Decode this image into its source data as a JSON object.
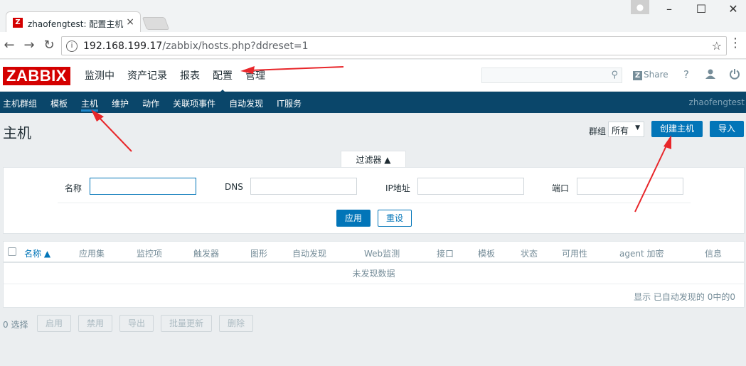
{
  "browser": {
    "tab_title": "zhaofengtest: 配置主机",
    "tab_close": "×",
    "url_host": "192.168.199.17",
    "url_path": "/zabbix/hosts.php?ddreset=1",
    "info_icon": "i"
  },
  "header": {
    "logo": "ZABBIX",
    "menu": [
      "监测中",
      "资产记录",
      "报表",
      "配置",
      "管理"
    ],
    "share_label": "Share",
    "help_label": "?"
  },
  "subnav": {
    "items": [
      "主机群组",
      "模板",
      "主机",
      "维护",
      "动作",
      "关联项事件",
      "自动发现",
      "IT服务"
    ],
    "user": "zhaofengtest"
  },
  "page": {
    "title": "主机",
    "group_label": "群组",
    "group_value": "所有",
    "create_button": "创建主机",
    "import_button": "导入"
  },
  "filter": {
    "tab_label": "过滤器 ▲",
    "name_label": "名称",
    "dns_label": "DNS",
    "ip_label": "IP地址",
    "port_label": "端口",
    "apply_button": "应用",
    "reset_button": "重设"
  },
  "table": {
    "columns": [
      "名称 ▲",
      "应用集",
      "监控项",
      "触发器",
      "图形",
      "自动发现",
      "Web监测",
      "接口",
      "模板",
      "状态",
      "可用性",
      "agent 加密",
      "信息"
    ],
    "no_data": "未发现数据",
    "paging": "显示 已自动发现的 0中的0"
  },
  "actions": {
    "selected": "0 选择",
    "buttons": [
      "启用",
      "禁用",
      "导出",
      "批量更新",
      "删除"
    ]
  },
  "colors": {
    "brand_red": "#d40000",
    "nav_blue": "#0a466a",
    "accent_blue": "#0275b8",
    "annotation_red": "#e8262a"
  }
}
